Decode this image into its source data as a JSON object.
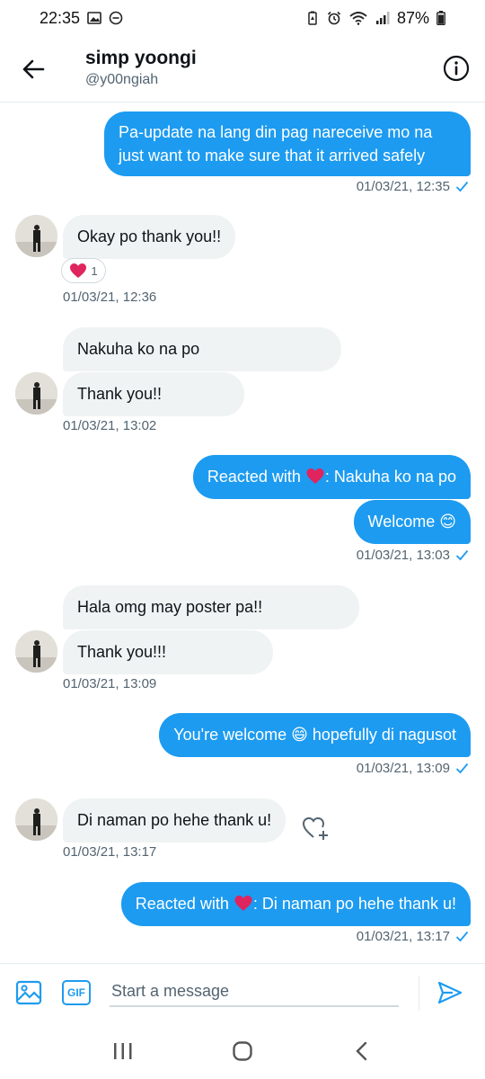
{
  "status_bar": {
    "time": "22:35",
    "battery": "87%"
  },
  "header": {
    "title": "simp yoongi",
    "handle": "@y00ngiah"
  },
  "messages": [
    {
      "text_line1": "Pa-update na lang din pag nareceive mo na",
      "text_line2": "just want to make sure that it arrived safely",
      "timestamp": "01/03/21, 12:35"
    },
    {
      "text": "Okay po thank you!!",
      "reaction_count": "1",
      "timestamp": "01/03/21, 12:36"
    },
    {
      "text": "Nakuha ko na po"
    },
    {
      "text": "Thank you!!",
      "timestamp": "01/03/21, 13:02"
    },
    {
      "prefix": "Reacted with ",
      "suffix": ": Nakuha ko na po"
    },
    {
      "text": "Welcome 😊",
      "timestamp": "01/03/21, 13:03"
    },
    {
      "text": "Hala omg may poster pa!!"
    },
    {
      "text": "Thank you!!!",
      "timestamp": "01/03/21, 13:09"
    },
    {
      "text": "You're welcome 😄 hopefully di nagusot",
      "timestamp": "01/03/21, 13:09"
    },
    {
      "text": "Di naman po hehe thank u!",
      "timestamp": "01/03/21, 13:17"
    },
    {
      "prefix": "Reacted with ",
      "suffix": ": Di naman po hehe thank u!",
      "timestamp": "01/03/21, 13:17"
    }
  ],
  "composer": {
    "placeholder": "Start a message",
    "gif_label": "GIF"
  },
  "icons": {
    "back": "arrow-left-icon",
    "info": "info-icon",
    "read_receipt": "checkmark-icon",
    "heart": "heart-icon",
    "add_reaction": "heart-plus-icon",
    "image": "image-icon",
    "send": "send-icon"
  },
  "colors": {
    "accent": "#1d9bf0",
    "incoming_bubble": "#eff3f4",
    "heart": "#e0245e",
    "muted_text": "#536471"
  }
}
